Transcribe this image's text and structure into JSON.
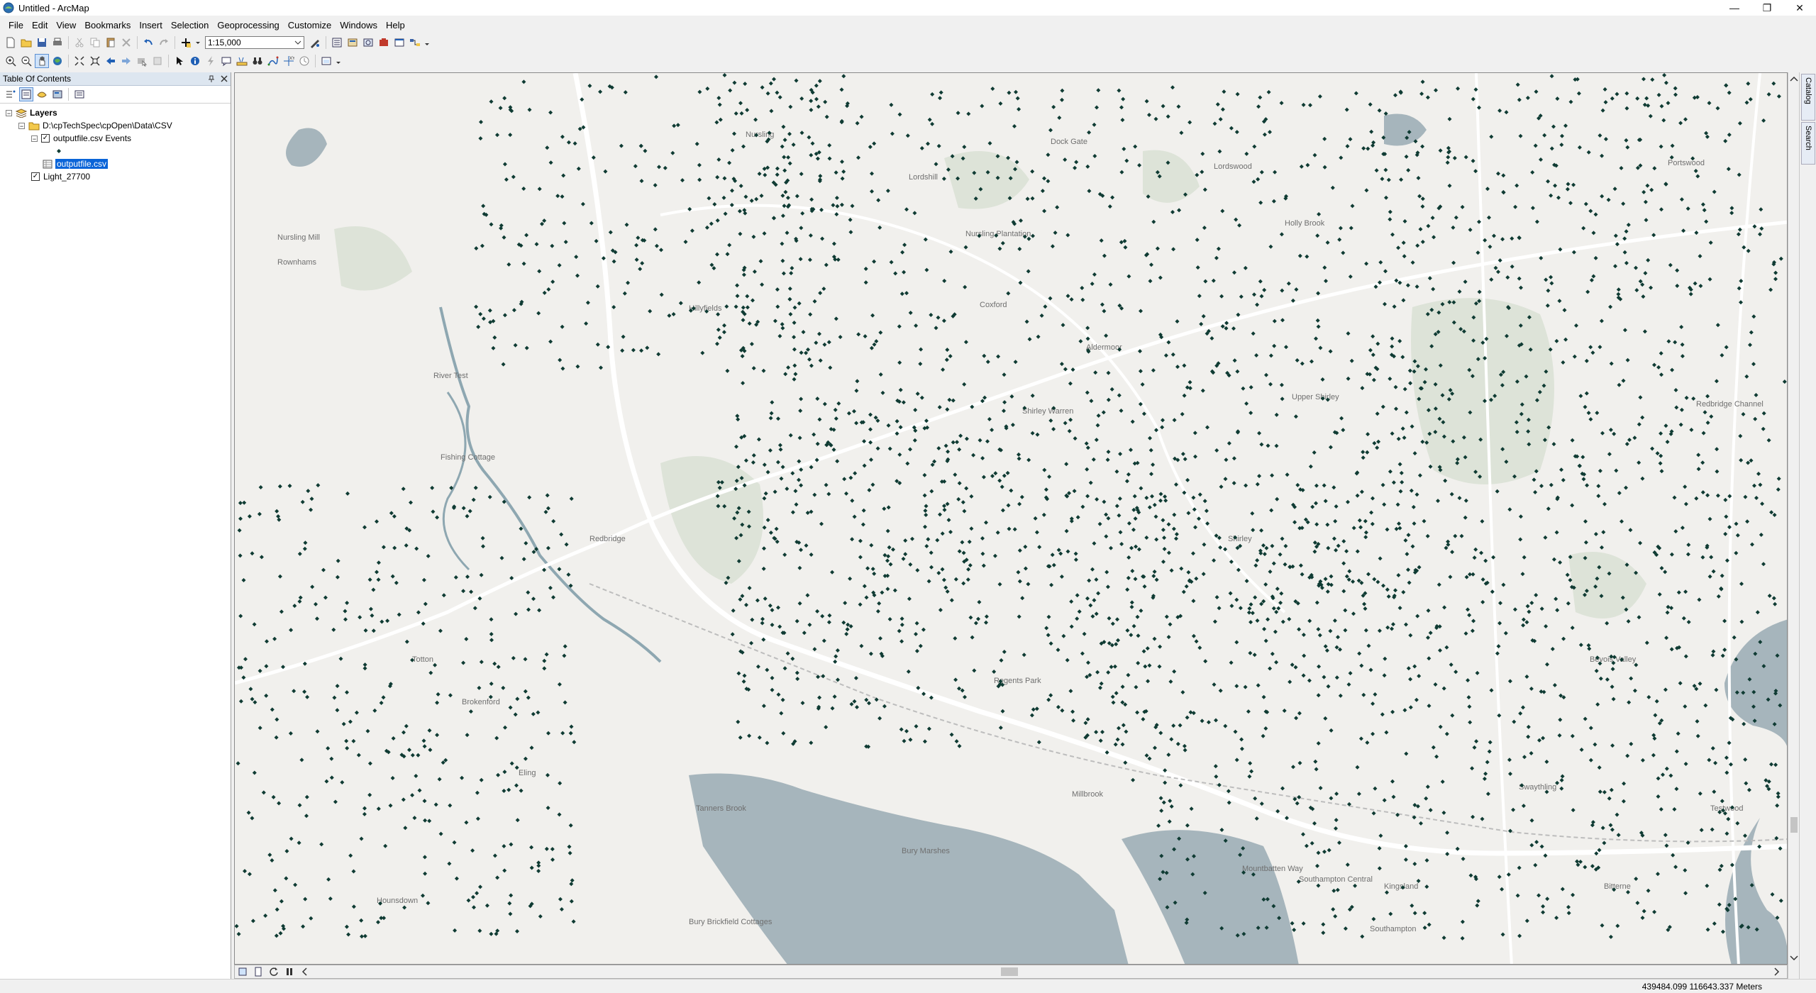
{
  "window": {
    "title": "Untitled - ArcMap"
  },
  "menubar": [
    "File",
    "Edit",
    "View",
    "Bookmarks",
    "Insert",
    "Selection",
    "Geoprocessing",
    "Customize",
    "Windows",
    "Help"
  ],
  "toolbar": {
    "scale_value": "1:15,000"
  },
  "toc": {
    "title": "Table Of Contents",
    "root_label": "Layers",
    "folder_label": "D:\\cpTechSpec\\cpOpen\\Data\\CSV",
    "events_layer_label": "outputfile.csv Events",
    "table_label": "outputfile.csv",
    "basemap_label": "Light_27700"
  },
  "map": {
    "labels": [
      "Nursling",
      "Nursling Mill",
      "Rownhams",
      "Lordswood",
      "Lordshill",
      "Holly Brook",
      "Hillyfields",
      "Coxford",
      "Aldermoor",
      "Shirley Warren",
      "Upper Shirley",
      "Shirley",
      "Redbridge",
      "Totton",
      "Brokenford",
      "Eling",
      "Millbrook",
      "Regents Park",
      "Southampton",
      "Southampton Central",
      "Kingsland",
      "Bitterne",
      "Bury Marshes",
      "Bury Brickfield Cottages",
      "Fishing Cottage",
      "River Test",
      "Mountbatten Way",
      "Nursling Plantation",
      "Hounsdown",
      "Bevois Valley",
      "Testwood",
      "Tanners Brook",
      "Redbridge Channel",
      "Portswood",
      "Swaythling",
      "Dock Gate"
    ],
    "point_color": "#0f3b33"
  },
  "sidebar": {
    "catalog_tab": "Catalog",
    "search_tab": "Search"
  },
  "status": {
    "coordinates": "439484.099  116643.337 Meters"
  }
}
